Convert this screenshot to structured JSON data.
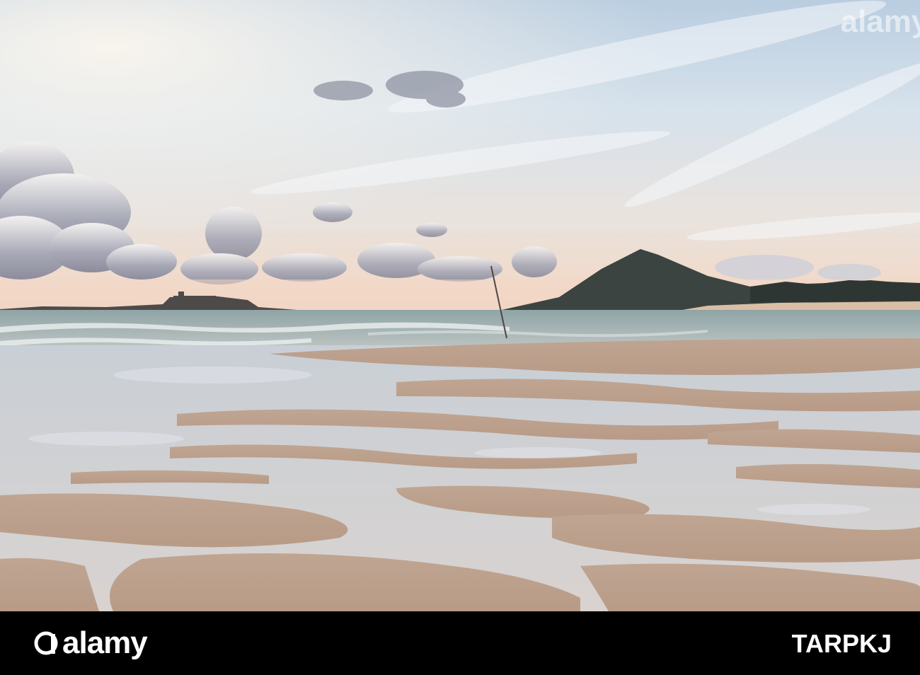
{
  "photo": {
    "subject": "beach-at-dusk",
    "watermark": "alamy"
  },
  "footer": {
    "brand": "alamy",
    "image_id": "TARPKJ",
    "background": "#000000",
    "text_color": "#ffffff"
  }
}
